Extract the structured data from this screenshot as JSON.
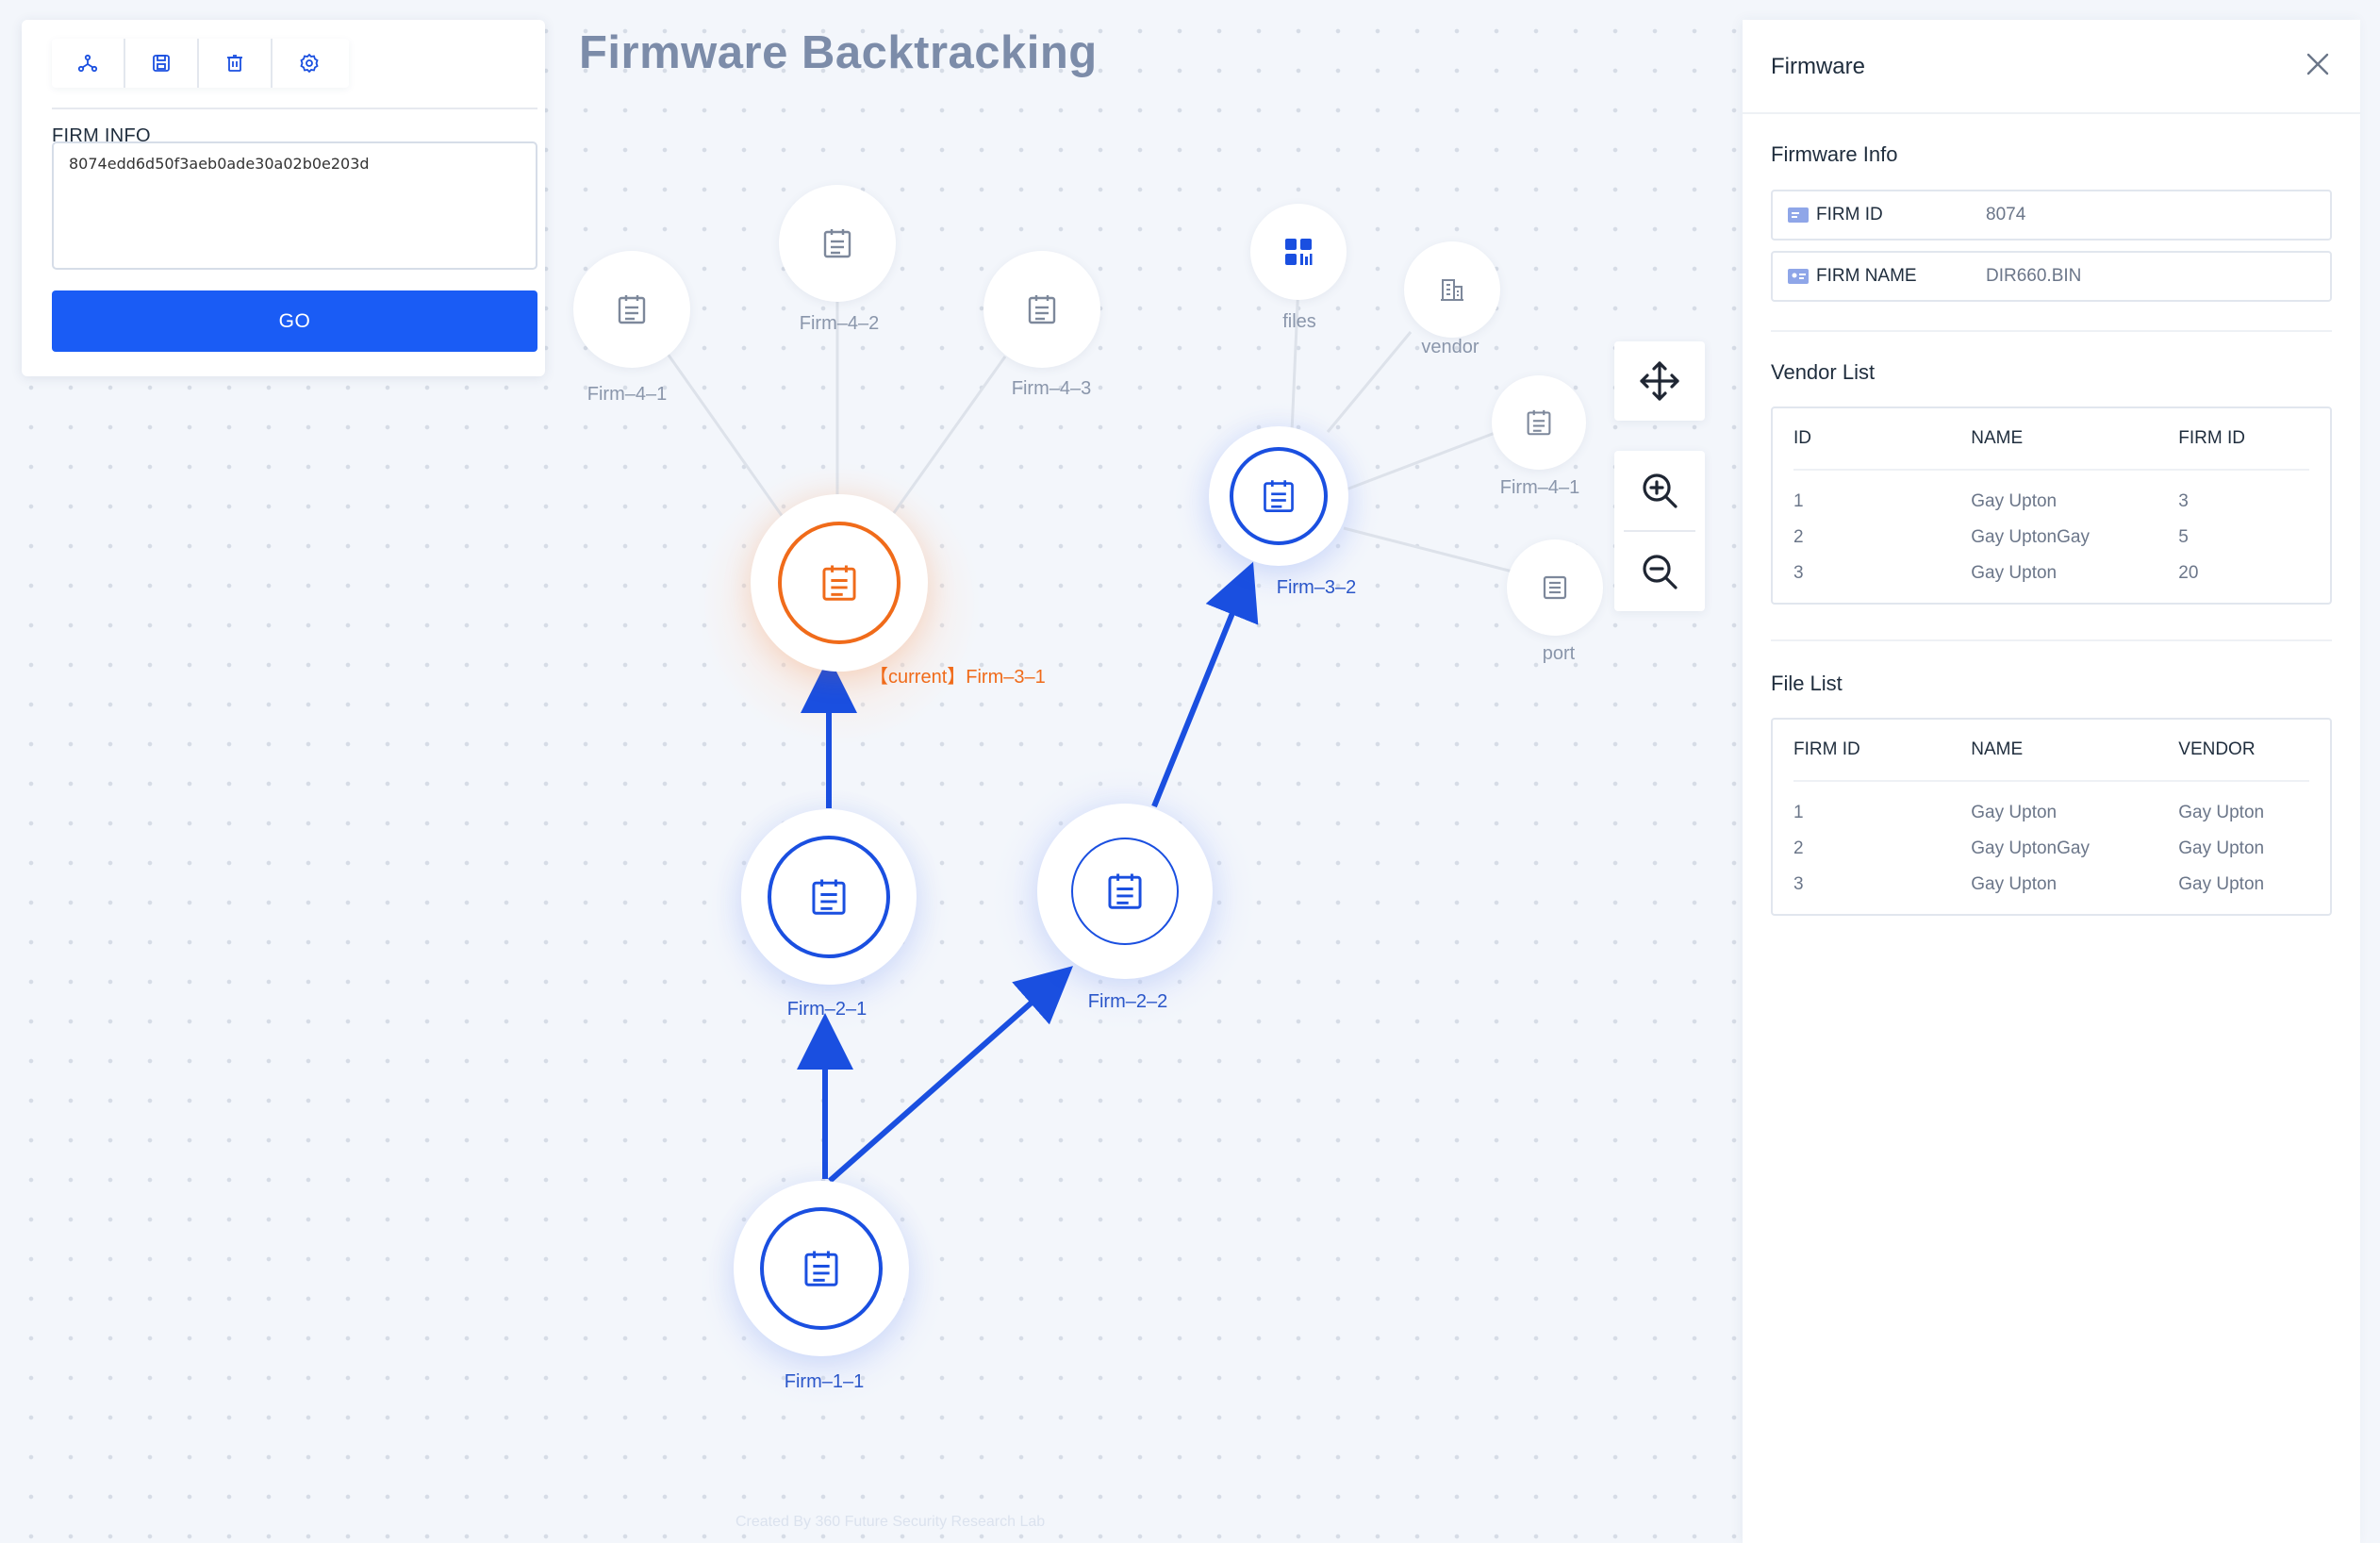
{
  "title": "Firmware Backtracking",
  "credit": "Created By 360 Future Security Research Lab",
  "left_panel": {
    "toolbar": [
      "graph-icon",
      "save-icon",
      "delete-icon",
      "settings-icon"
    ],
    "firm_label": "FIRM INFO",
    "firm_value": "8074edd6d50f3aeb0ade30a02b0e203d",
    "go_label": "GO"
  },
  "graph": {
    "nodes": {
      "firm_4_1_a": "Firm–4–1",
      "firm_4_2": "Firm–4–2",
      "firm_4_3": "Firm–4–3",
      "firm_3_1": "【current】Firm–3–1",
      "firm_2_1": "Firm–2–1",
      "firm_2_2": "Firm–2–2",
      "firm_1_1": "Firm–1–1",
      "firm_3_2": "Firm–3–2",
      "files": "files",
      "vendor": "vendor",
      "firm_4_1_b": "Firm–4–1",
      "port": "port"
    },
    "colors": {
      "accent": "#1a4fe0",
      "current": "#f06b1a",
      "muted": "#8a96ab"
    }
  },
  "controls": [
    "move-icon",
    "zoom-in-icon",
    "zoom-out-icon"
  ],
  "right_panel": {
    "title": "Firmware",
    "firmware_info": {
      "title": "Firmware Info",
      "firm_id_key": "FIRM ID",
      "firm_id_value": "8074",
      "firm_name_key": "FIRM NAME",
      "firm_name_value": "DIR660.BIN"
    },
    "vendor_list": {
      "title": "Vendor List",
      "headers": [
        "ID",
        "NAME",
        "FIRM ID"
      ],
      "rows": [
        [
          "1",
          "Gay Upton",
          "3"
        ],
        [
          "2",
          "Gay UptonGay",
          "5"
        ],
        [
          "3",
          "Gay Upton",
          "20"
        ]
      ]
    },
    "file_list": {
      "title": "File List",
      "headers": [
        "FIRM ID",
        "NAME",
        "VENDOR"
      ],
      "rows": [
        [
          "1",
          "Gay Upton",
          "Gay Upton"
        ],
        [
          "2",
          "Gay UptonGay",
          "Gay Upton"
        ],
        [
          "3",
          "Gay Upton",
          "Gay Upton"
        ]
      ]
    }
  }
}
